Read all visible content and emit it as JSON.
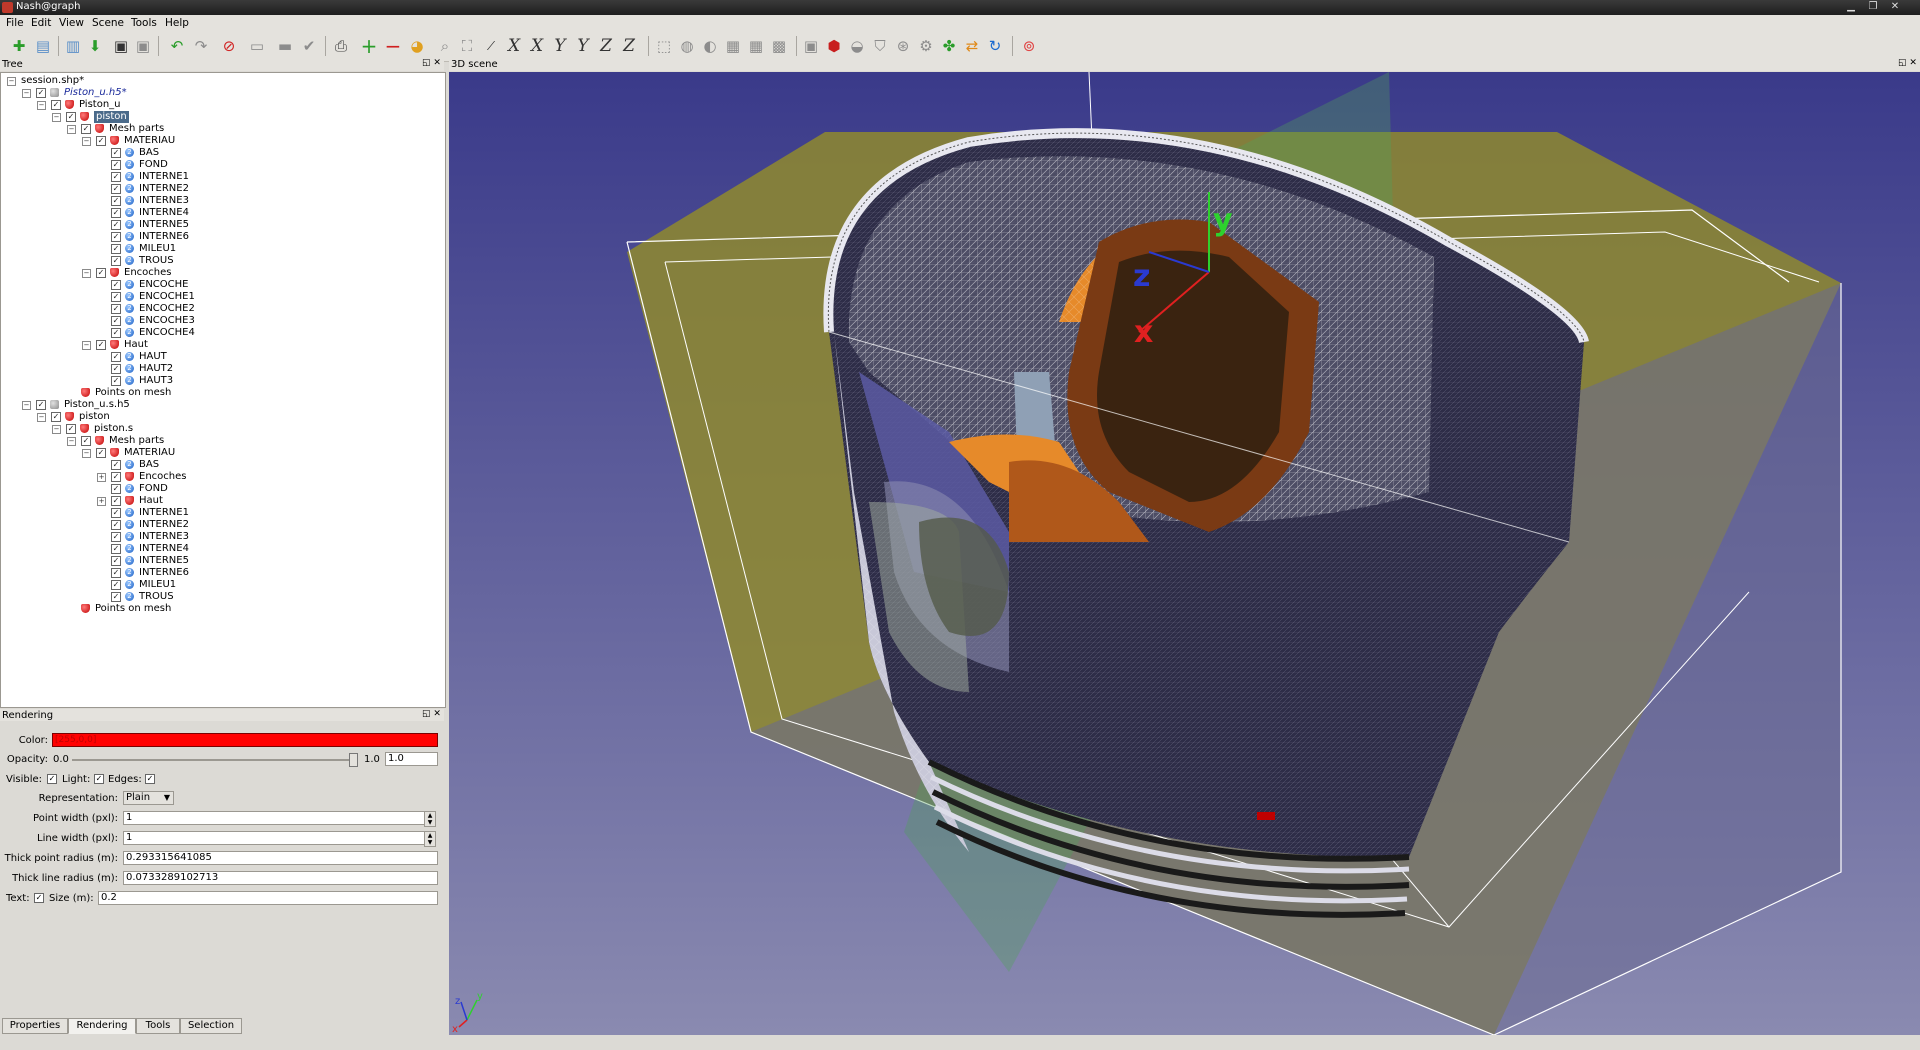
{
  "window": {
    "title": "Nash@graph",
    "controls": [
      "▁",
      "❐",
      "✕"
    ]
  },
  "menu": [
    "File",
    "Edit",
    "View",
    "Scene",
    "Tools",
    "Help"
  ],
  "axis_buttons": [
    "X",
    "X",
    "Y",
    "Y",
    "Z",
    "Z"
  ],
  "tree_panel": {
    "title": "Tree",
    "controls": "◱ ✕"
  },
  "scene_panel": {
    "title": "3D scene",
    "controls": "◱ ✕"
  },
  "tree": [
    {
      "level": 0,
      "expander": "−",
      "checkbox": false,
      "icon": "none",
      "label": "session.shp*"
    },
    {
      "level": 1,
      "expander": "−",
      "checkbox": true,
      "icon": "gray",
      "label": "Piston_u.h5*",
      "italic": true
    },
    {
      "level": 2,
      "expander": "−",
      "checkbox": true,
      "icon": "red",
      "label": "Piston_u"
    },
    {
      "level": 3,
      "expander": "−",
      "checkbox": true,
      "icon": "red",
      "label": "piston",
      "selected": true
    },
    {
      "level": 4,
      "expander": "−",
      "checkbox": true,
      "icon": "red",
      "label": "Mesh parts"
    },
    {
      "level": 5,
      "expander": "−",
      "checkbox": true,
      "icon": "red",
      "label": "MATERIAU"
    },
    {
      "level": 6,
      "expander": "",
      "checkbox": true,
      "icon": "blue",
      "label": "BAS"
    },
    {
      "level": 6,
      "expander": "",
      "checkbox": true,
      "icon": "blue",
      "label": "FOND"
    },
    {
      "level": 6,
      "expander": "",
      "checkbox": true,
      "icon": "blue",
      "label": "INTERNE1"
    },
    {
      "level": 6,
      "expander": "",
      "checkbox": true,
      "icon": "blue",
      "label": "INTERNE2"
    },
    {
      "level": 6,
      "expander": "",
      "checkbox": true,
      "icon": "blue",
      "label": "INTERNE3"
    },
    {
      "level": 6,
      "expander": "",
      "checkbox": true,
      "icon": "blue",
      "label": "INTERNE4"
    },
    {
      "level": 6,
      "expander": "",
      "checkbox": true,
      "icon": "blue",
      "label": "INTERNE5"
    },
    {
      "level": 6,
      "expander": "",
      "checkbox": true,
      "icon": "blue",
      "label": "INTERNE6"
    },
    {
      "level": 6,
      "expander": "",
      "checkbox": true,
      "icon": "blue",
      "label": "MILEU1"
    },
    {
      "level": 6,
      "expander": "",
      "checkbox": true,
      "icon": "blue",
      "label": "TROUS"
    },
    {
      "level": 5,
      "expander": "−",
      "checkbox": true,
      "icon": "red",
      "label": "Encoches"
    },
    {
      "level": 6,
      "expander": "",
      "checkbox": true,
      "icon": "blue",
      "label": "ENCOCHE"
    },
    {
      "level": 6,
      "expander": "",
      "checkbox": true,
      "icon": "blue",
      "label": "ENCOCHE1"
    },
    {
      "level": 6,
      "expander": "",
      "checkbox": true,
      "icon": "blue",
      "label": "ENCOCHE2"
    },
    {
      "level": 6,
      "expander": "",
      "checkbox": true,
      "icon": "blue",
      "label": "ENCOCHE3"
    },
    {
      "level": 6,
      "expander": "",
      "checkbox": true,
      "icon": "blue",
      "label": "ENCOCHE4"
    },
    {
      "level": 5,
      "expander": "−",
      "checkbox": true,
      "icon": "red",
      "label": "Haut"
    },
    {
      "level": 6,
      "expander": "",
      "checkbox": true,
      "icon": "blue",
      "label": "HAUT"
    },
    {
      "level": 6,
      "expander": "",
      "checkbox": true,
      "icon": "blue",
      "label": "HAUT2"
    },
    {
      "level": 6,
      "expander": "",
      "checkbox": true,
      "icon": "blue",
      "label": "HAUT3"
    },
    {
      "level": 4,
      "expander": "",
      "checkbox": false,
      "icon": "red",
      "label": "Points on mesh"
    },
    {
      "level": 1,
      "expander": "−",
      "checkbox": true,
      "icon": "gray",
      "label": "Piston_u.s.h5"
    },
    {
      "level": 2,
      "expander": "−",
      "checkbox": true,
      "icon": "red",
      "label": "piston"
    },
    {
      "level": 3,
      "expander": "−",
      "checkbox": true,
      "icon": "red",
      "label": "piston.s"
    },
    {
      "level": 4,
      "expander": "−",
      "checkbox": true,
      "icon": "red",
      "label": "Mesh parts"
    },
    {
      "level": 5,
      "expander": "−",
      "checkbox": true,
      "icon": "red",
      "label": "MATERIAU"
    },
    {
      "level": 6,
      "expander": "",
      "checkbox": true,
      "icon": "blue",
      "label": "BAS"
    },
    {
      "level": 6,
      "expander": "+",
      "checkbox": true,
      "icon": "red",
      "label": "Encoches"
    },
    {
      "level": 6,
      "expander": "",
      "checkbox": true,
      "icon": "blue",
      "label": "FOND"
    },
    {
      "level": 6,
      "expander": "+",
      "checkbox": true,
      "icon": "red",
      "label": "Haut"
    },
    {
      "level": 6,
      "expander": "",
      "checkbox": true,
      "icon": "blue",
      "label": "INTERNE1"
    },
    {
      "level": 6,
      "expander": "",
      "checkbox": true,
      "icon": "blue",
      "label": "INTERNE2"
    },
    {
      "level": 6,
      "expander": "",
      "checkbox": true,
      "icon": "blue",
      "label": "INTERNE3"
    },
    {
      "level": 6,
      "expander": "",
      "checkbox": true,
      "icon": "blue",
      "label": "INTERNE4"
    },
    {
      "level": 6,
      "expander": "",
      "checkbox": true,
      "icon": "blue",
      "label": "INTERNE5"
    },
    {
      "level": 6,
      "expander": "",
      "checkbox": true,
      "icon": "blue",
      "label": "INTERNE6"
    },
    {
      "level": 6,
      "expander": "",
      "checkbox": true,
      "icon": "blue",
      "label": "MILEU1"
    },
    {
      "level": 6,
      "expander": "",
      "checkbox": true,
      "icon": "blue",
      "label": "TROUS"
    },
    {
      "level": 4,
      "expander": "",
      "checkbox": false,
      "icon": "red",
      "label": "Points on mesh"
    }
  ],
  "rendering": {
    "title": "Rendering",
    "controls": "◱ ✕",
    "color_label": "Color:",
    "color_value": "[255,0,0]",
    "color_hex": "#ff0000",
    "opacity_label": "Opacity:",
    "opacity_min": "0.0",
    "opacity_max": "1.0",
    "opacity_value": "1.0",
    "opacity_fraction": 1.0,
    "visible_label": "Visible:",
    "light_label": "Light:",
    "edges_label": "Edges:",
    "representation_label": "Representation:",
    "representation_value": "Plain",
    "point_width_label": "Point width (pxl):",
    "point_width_value": "1",
    "line_width_label": "Line width (pxl):",
    "line_width_value": "1",
    "thick_point_label": "Thick point radius (m):",
    "thick_point_value": "0.293315641085",
    "thick_line_label": "Thick line radius (m):",
    "thick_line_value": "0.0733289102713",
    "text_label": "Text:",
    "size_label": "Size (m):",
    "size_value": "0.2"
  },
  "bottom_tabs": [
    "Properties",
    "Rendering",
    "Tools",
    "Selection"
  ],
  "active_tab": "Rendering",
  "scene_axes": {
    "x": "x",
    "y": "y",
    "z": "z"
  },
  "colors": {
    "viewport_top": "#3a3a8a",
    "viewport_bottom": "#8a8ab0",
    "box_fill": "#8f8a2e",
    "piston_orange": "#e68a2a",
    "mesh_dark": "#2e2d48",
    "mesh_light": "#c8c8d8",
    "axis_x": "#e02020",
    "axis_y": "#2ed12e",
    "axis_z": "#2a3ad0"
  }
}
